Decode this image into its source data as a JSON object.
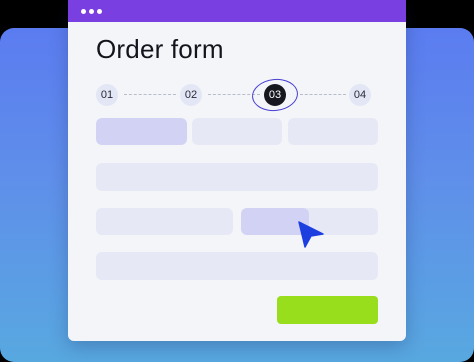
{
  "form": {
    "title": "Order form"
  },
  "steps": [
    {
      "label": "01",
      "active": false
    },
    {
      "label": "02",
      "active": false
    },
    {
      "label": "03",
      "active": true
    },
    {
      "label": "04",
      "active": false
    }
  ],
  "colors": {
    "title_bar": "#7a3fe0",
    "submit_button": "#98de1c",
    "active_step": "#171720",
    "cursor": "#1d3fe0"
  },
  "icons": {
    "window_controls": "three-dots-icon",
    "pointer": "cursor-arrow-icon"
  }
}
